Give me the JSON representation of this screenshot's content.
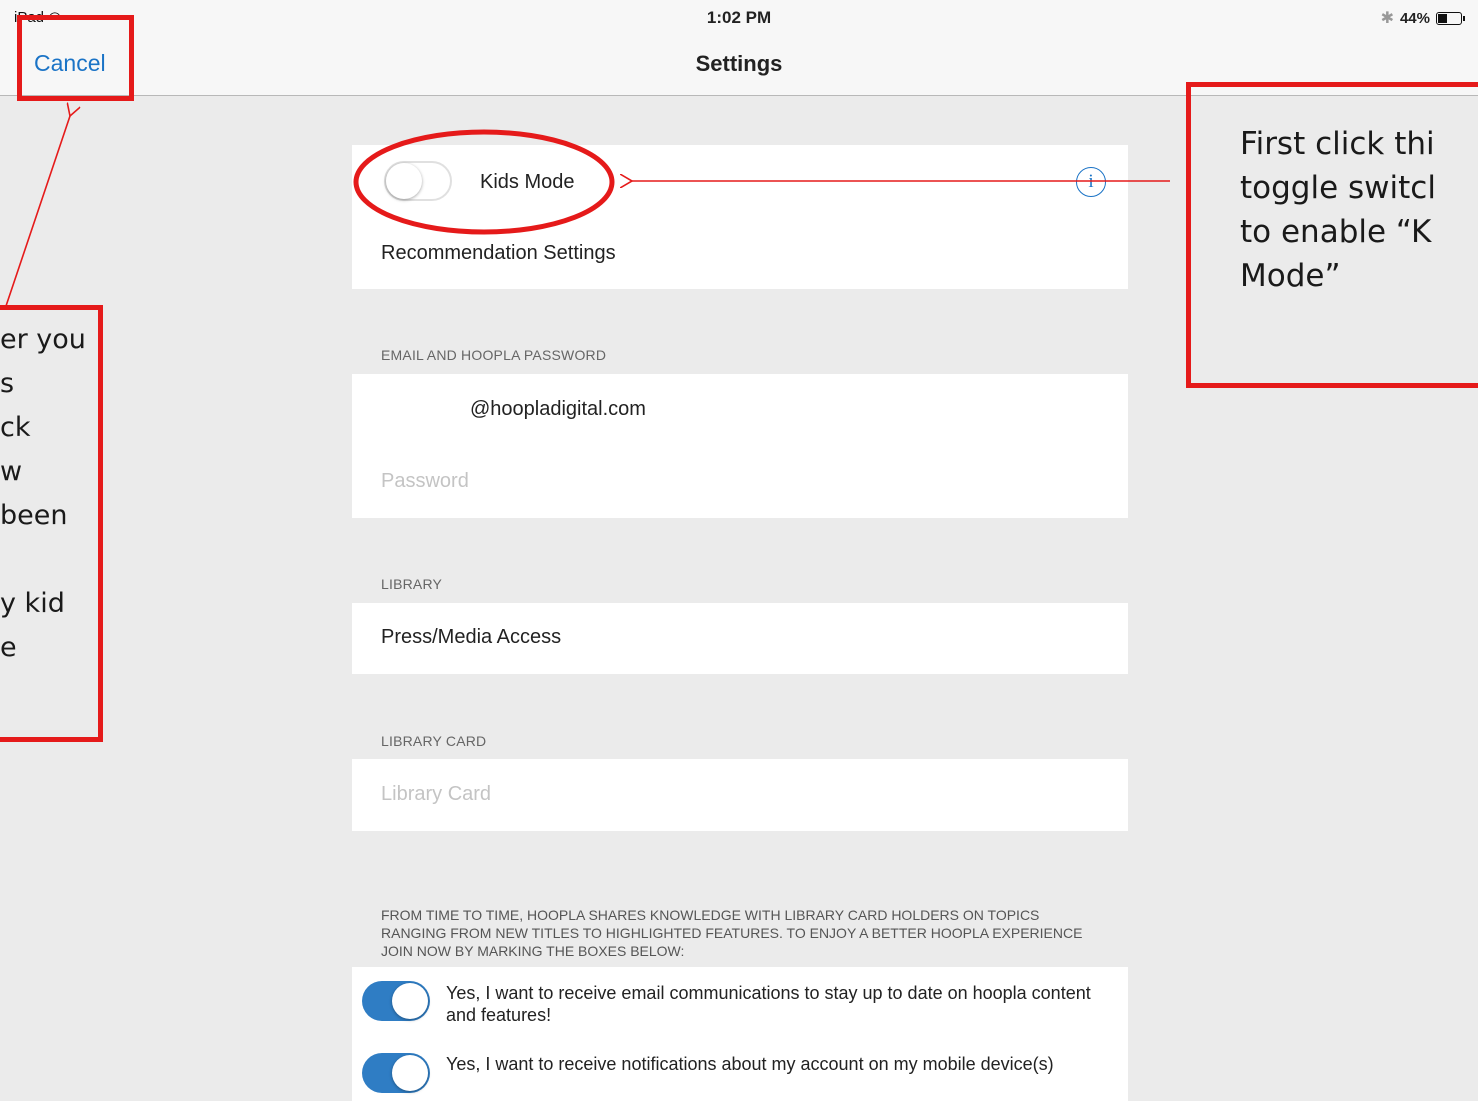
{
  "status_bar": {
    "device": "iPad",
    "wifi_icon": "wifi-icon",
    "time": "1:02 PM",
    "bluetooth_icon": "bluetooth-icon",
    "battery": "44%",
    "battery_level": 0.44
  },
  "nav": {
    "cancel_label": "Cancel",
    "title": "Settings"
  },
  "kids_section": {
    "kids_mode_label": "Kids Mode",
    "kids_mode_on": false,
    "info_icon": "info-icon",
    "info_glyph": "i",
    "recommendation_label": "Recommendation Settings"
  },
  "email_section": {
    "header": "EMAIL AND HOOPLA PASSWORD",
    "email_value": "@hoopladigital.com",
    "password_placeholder": "Password"
  },
  "library_section": {
    "header": "LIBRARY",
    "library_value": "Press/Media Access"
  },
  "library_card_section": {
    "header": "LIBRARY CARD",
    "card_placeholder": "Library Card"
  },
  "communications": {
    "disclaimer": "FROM TIME TO TIME, HOOPLA SHARES KNOWLEDGE WITH LIBRARY CARD HOLDERS ON TOPICS RANGING FROM NEW TITLES TO HIGHLIGHTED FEATURES. TO ENJOY A BETTER HOOPLA EXPERIENCE JOIN NOW BY MARKING THE BOXES BELOW:",
    "options": [
      {
        "label": "Yes, I want to receive email communications to stay up to date on hoopla content and features!",
        "on": true
      },
      {
        "label": "Yes, I want to  receive notifications about my account on my mobile device(s)",
        "on": true
      }
    ]
  },
  "annotations": {
    "right_note": [
      "First click thi",
      "toggle switcl",
      "to enable “K",
      "Mode”"
    ],
    "left_note": [
      "er you",
      "s",
      "ck",
      "w",
      "been",
      "",
      "y kid",
      "e"
    ],
    "accent_color": "#e51a1a"
  }
}
